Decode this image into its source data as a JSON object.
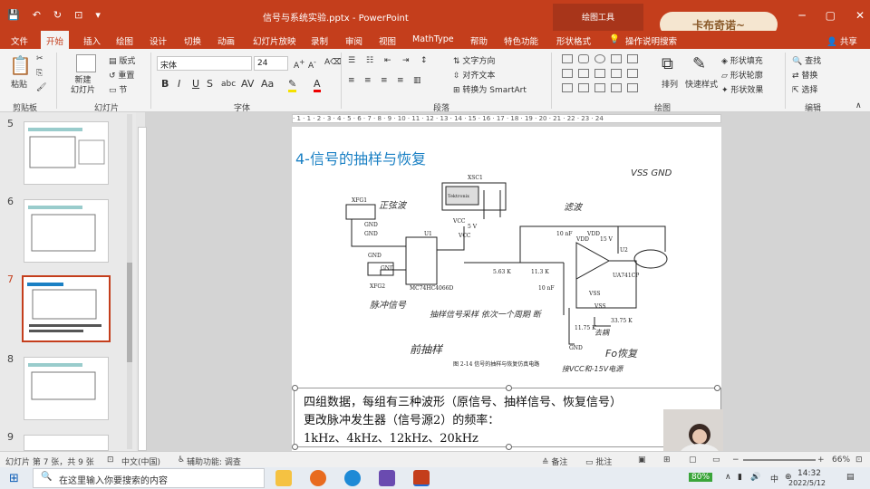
{
  "titlebar": {
    "quick_access": [
      "💾",
      "↶",
      "↻",
      "⊡",
      "▾"
    ],
    "title": "信号与系统实验.pptx - PowerPoint",
    "context_tab": "绘图工具",
    "badge": "卡布奇诺~",
    "window_controls": [
      "─",
      "▢",
      "✕"
    ]
  },
  "menu": {
    "items": [
      "文件",
      "开始",
      "插入",
      "绘图",
      "设计",
      "切换",
      "动画",
      "幻灯片放映",
      "录制",
      "审阅",
      "视图",
      "MathType",
      "帮助",
      "特色功能",
      "形状格式"
    ],
    "active": "开始",
    "tell_me": "操作说明搜索",
    "share": "共享"
  },
  "ribbon": {
    "groups": [
      "剪贴板",
      "幻灯片",
      "字体",
      "段落",
      "绘图",
      "编辑"
    ],
    "paste": "粘贴",
    "new_slide": "新建\n幻灯片",
    "layout": "版式",
    "reset": "重置",
    "section": "节",
    "font_name": "宋体",
    "font_size": "24",
    "text_direction": "文字方向",
    "align_text": "对齐文本",
    "smartart": "转换为 SmartArt",
    "arrange": "排列",
    "quick_styles": "快速样式",
    "shape_fill": "形状填充",
    "shape_outline": "形状轮廓",
    "shape_effects": "形状效果",
    "find": "查找",
    "replace": "替换",
    "select": "选择"
  },
  "thumbnails": {
    "numbers": [
      "5",
      "6",
      "7",
      "8",
      "9"
    ],
    "selected": "7"
  },
  "ruler": {
    "h_ticks": "· 1 · 1 · 2 · 3 · 4 · 5 · 6 · 7 · 8 · 9 · 10 · 11 · 12 · 13 · 14 · 15 · 16 · 17 · 18 · 19 · 20 · 21 · 22 · 23 · 24"
  },
  "slide": {
    "title": "4-信号的抽样与恢复",
    "circuit": {
      "scope": "XSC1",
      "scope_inner": "Tektronix",
      "gen1": "XFG1",
      "gen2": "XFG2",
      "gnd": "GND",
      "vcc": "VCC",
      "v5": "5 V",
      "chip": "U1",
      "chip_name": "MC74HC4066D",
      "r1": "5.63 K",
      "r2": "11.3 K",
      "cap1": "10 nF",
      "cap2": "10 nF",
      "vdd": "VDD",
      "v15": "15 V",
      "opamp": "UA741CP",
      "u2": "U2",
      "vss": "VSS",
      "r3": "11.75 K",
      "r4": "33.75 K",
      "caption": "图 2-14  信号的抽样与恢复仿真电路"
    },
    "handwriting": {
      "sine": "正弦波",
      "vss_gnd": "VSS\nGND",
      "circuit_mark": "滤波",
      "pulse": "脉冲信号",
      "sampling_note": "抽样信号采样\n依次一个周期\n断",
      "pre_sample": "前抽样",
      "after_recover": "Fo恢复",
      "note_bottom": "接VCC和-15V电源",
      "small_note": "去耦"
    },
    "body": [
      "四组数据，每组有三种波形（原信号、抽样信号、恢复信号）",
      "更改脉冲发生器（信号源2）的频率：",
      "1kHz、4kHz、12kHz、20kHz"
    ]
  },
  "status": {
    "slide_info": "幻灯片 第 7 张，共 9 张",
    "language": "中文(中国)",
    "accessibility": "辅助功能: 调查",
    "notes": "备注",
    "comments": "批注",
    "zoom": "66%"
  },
  "taskbar": {
    "search_placeholder": "在这里输入你要搜索的内容",
    "battery": "80%",
    "ime": "中",
    "time": "14:32",
    "date": "2022/5/12"
  }
}
